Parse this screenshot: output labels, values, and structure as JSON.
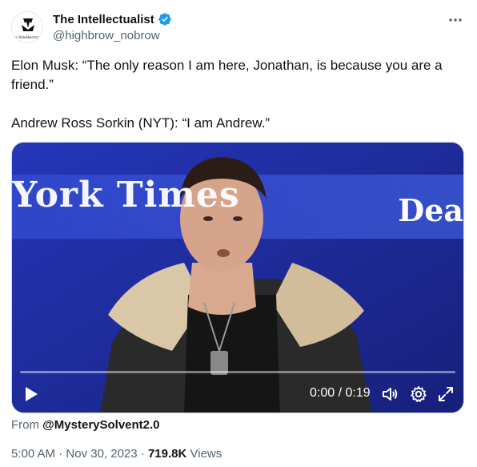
{
  "author": {
    "display_name": "The Intellectualist",
    "handle": "@highbrow_nobrow",
    "avatar_caption": "The Intellectualist"
  },
  "tweet": {
    "line1": "Elon Musk: “The only reason I am here, Jonathan, is because you are a friend.”",
    "line2": "Andrew Ross Sorkin (NYT): “I am Andrew.”"
  },
  "video": {
    "backdrop_left_text": "York Times",
    "backdrop_right_text": "Dea",
    "time": "0:00 / 0:19",
    "progress": 0
  },
  "from": {
    "label": "From",
    "handle": "@MysterySolvent2.0"
  },
  "meta": {
    "time": "5:00 AM",
    "sep1": "·",
    "date": "Nov 30, 2023",
    "sep2": "·",
    "views_count": "719.8K",
    "views_label": "Views"
  },
  "icons": {
    "verified": "verified-badge-icon",
    "more": "more-icon",
    "play": "play-icon",
    "volume": "volume-icon",
    "settings": "gear-icon",
    "fullscreen": "expand-icon"
  },
  "colors": {
    "verified": "#1d9bf0",
    "text": "#0f1419",
    "secondary": "#536471",
    "video_bg": "#1f2fa0"
  }
}
